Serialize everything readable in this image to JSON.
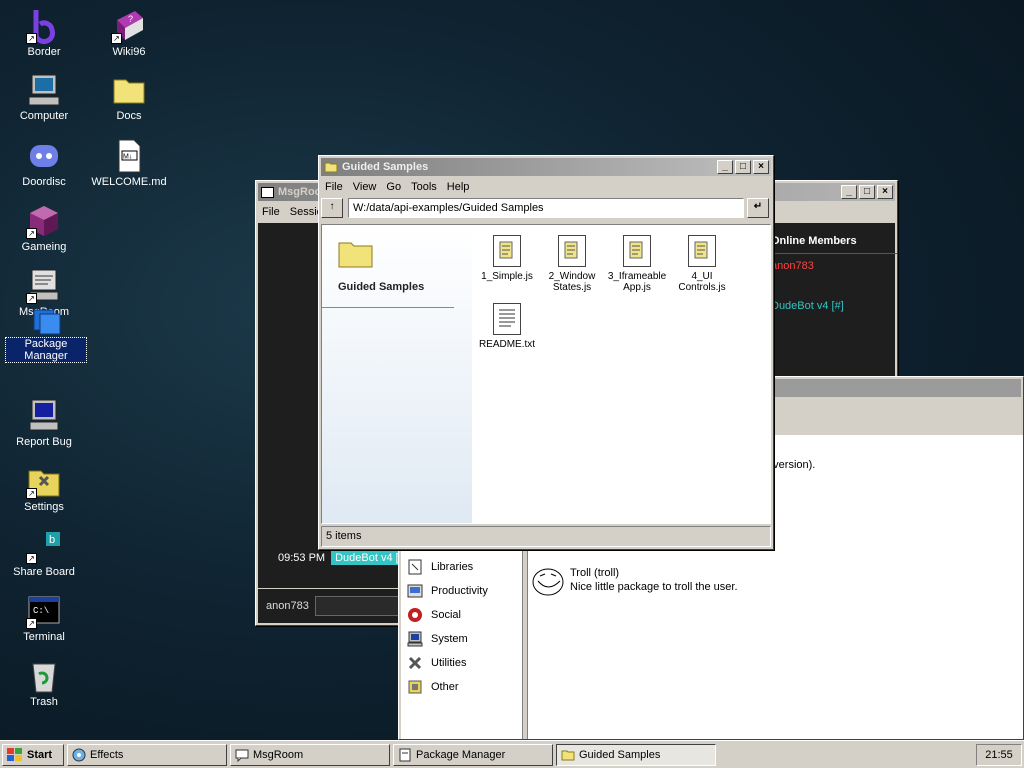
{
  "desktop": {
    "icons": [
      {
        "label": "Border"
      },
      {
        "label": "Wiki96"
      },
      {
        "label": "Computer"
      },
      {
        "label": "Docs"
      },
      {
        "label": "Doordisc"
      },
      {
        "label": "WELCOME.md"
      },
      {
        "label": "Gameing"
      },
      {
        "label": "MsgRoom"
      },
      {
        "label": "Package Manager"
      },
      {
        "label": "Report Bug"
      },
      {
        "label": "Settings"
      },
      {
        "label": "Share Board"
      },
      {
        "label": "Terminal"
      },
      {
        "label": "Trash"
      }
    ]
  },
  "msgroom": {
    "title": "MsgRoom",
    "menu": [
      "File",
      "Session"
    ],
    "members_header": "Online Members",
    "members": [
      "anon783",
      "DudeBot v4 [#]"
    ],
    "message_time": "09:53 PM",
    "message_user": "DudeBot v4 [#]",
    "input_user": "anon783",
    "colors": {
      "anon": "#ff4040",
      "bot": "#33c4c4"
    }
  },
  "package_manager": {
    "title": "Package Manager",
    "partial_text": "e version).",
    "categories": [
      "Libraries",
      "Productivity",
      "Social",
      "System",
      "Utilities",
      "Other"
    ],
    "packages": [
      {
        "name": "Troll (troll)",
        "desc": "Nice little package to troll the user."
      }
    ]
  },
  "explorer": {
    "title": "Guided Samples",
    "menu": [
      "File",
      "View",
      "Go",
      "Tools",
      "Help"
    ],
    "address": "W:/data/api-examples/Guided Samples",
    "folder_label": "Guided Samples",
    "files": [
      {
        "name": "1_Simple.js",
        "type": "js"
      },
      {
        "name": "2_Window States.js",
        "type": "js"
      },
      {
        "name": "3_Iframeable App.js",
        "type": "js"
      },
      {
        "name": "4_UI Controls.js",
        "type": "js"
      },
      {
        "name": "README.txt",
        "type": "txt"
      }
    ],
    "status": "5 items"
  },
  "taskbar": {
    "start_label": "Start",
    "tasks": [
      {
        "label": "Effects"
      },
      {
        "label": "MsgRoom"
      },
      {
        "label": "Package Manager"
      },
      {
        "label": "Guided Samples"
      }
    ],
    "clock": "21:55"
  }
}
